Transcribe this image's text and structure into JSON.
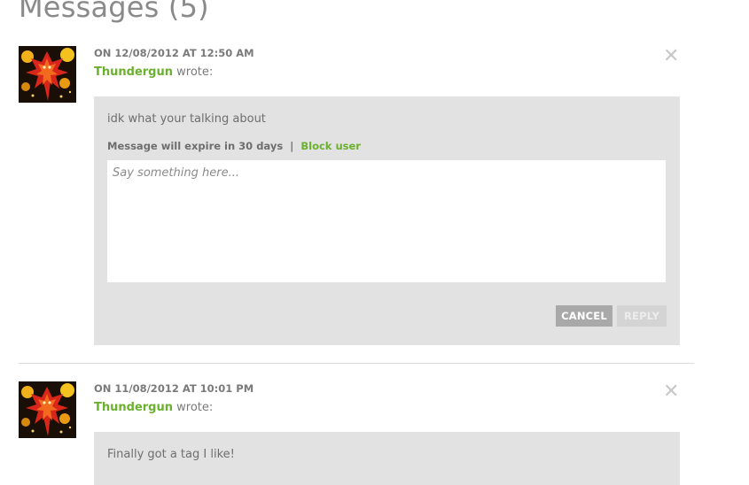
{
  "page": {
    "title": "Messages (5)"
  },
  "messages": [
    {
      "date": "ON 12/08/2012 AT 12:50 AM",
      "author": "Thundergun",
      "wrote": "wrote:",
      "text": "idk what your talking about",
      "expire": "Message will expire in 30 days",
      "separator": "|",
      "block_label": "Block user",
      "reply_placeholder": "Say something here...",
      "cancel_label": "CANCEL",
      "reply_label": "REPLY",
      "close_icon": "close-icon"
    },
    {
      "date": "ON 11/08/2012 AT 10:01 PM",
      "author": "Thundergun",
      "wrote": "wrote:",
      "text": "Finally got a tag I like!",
      "close_icon": "close-icon"
    }
  ],
  "colors": {
    "accent_green": "#6bb02e",
    "bubble_gray": "#e2e2e2",
    "cancel_gray": "#a9a9a9",
    "reply_disabled": "#d4d4d4"
  }
}
